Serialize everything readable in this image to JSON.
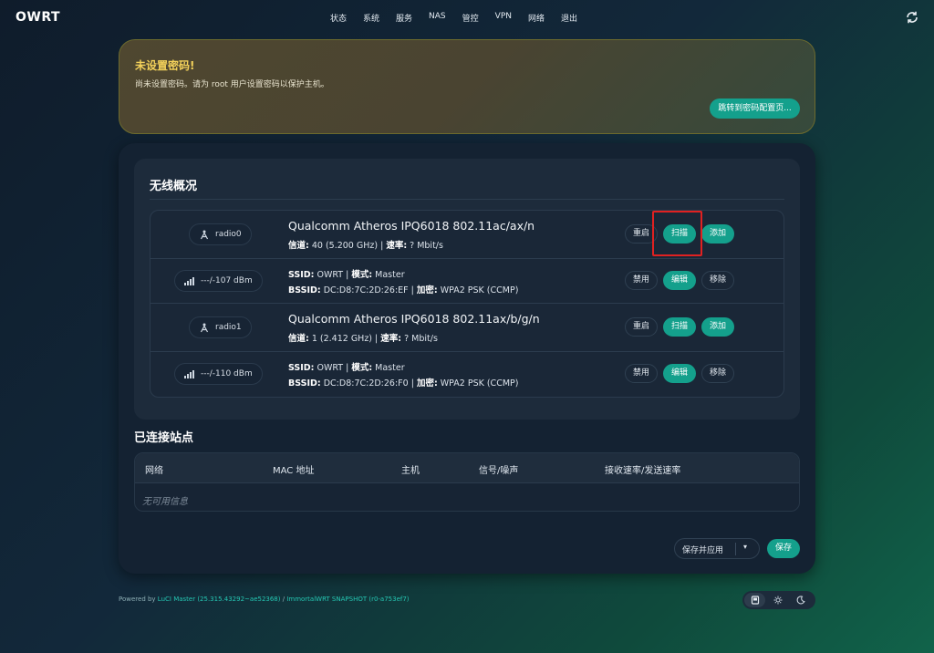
{
  "brand": "OWRT",
  "nav": [
    "状态",
    "系统",
    "服务",
    "NAS",
    "管控",
    "VPN",
    "网络",
    "退出"
  ],
  "warning": {
    "title": "未设置密码!",
    "text": "尚未设置密码。请为 root 用户设置密码以保护主机。",
    "button": "跳转到密码配置页..."
  },
  "wireless": {
    "title": "无线概况",
    "devices": [
      {
        "radio": "radio0",
        "title": "Qualcomm Atheros IPQ6018 802.11ac/ax/n",
        "channel_label": "信道:",
        "channel": " 40 (5.200 GHz) | ",
        "rate_label": "速率:",
        "rate": " ? Mbit/s",
        "buttons": [
          "重启",
          "扫描",
          "添加"
        ],
        "network": {
          "signal": "---/-107 dBm",
          "ssid_label": "SSID:",
          "ssid": " OWRT | ",
          "mode_label": "模式:",
          "mode": " Master",
          "bssid_label": "BSSID:",
          "bssid": " DC:D8:7C:2D:26:EF | ",
          "enc_label": "加密:",
          "enc": " WPA2 PSK (CCMP)",
          "buttons": [
            "禁用",
            "编辑",
            "移除"
          ]
        }
      },
      {
        "radio": "radio1",
        "title": "Qualcomm Atheros IPQ6018 802.11ax/b/g/n",
        "channel_label": "信道:",
        "channel": " 1 (2.412 GHz) | ",
        "rate_label": "速率:",
        "rate": " ? Mbit/s",
        "buttons": [
          "重启",
          "扫描",
          "添加"
        ],
        "network": {
          "signal": "---/-110 dBm",
          "ssid_label": "SSID:",
          "ssid": " OWRT | ",
          "mode_label": "模式:",
          "mode": " Master",
          "bssid_label": "BSSID:",
          "bssid": " DC:D8:7C:2D:26:F0 | ",
          "enc_label": "加密:",
          "enc": " WPA2 PSK (CCMP)",
          "buttons": [
            "禁用",
            "编辑",
            "移除"
          ]
        }
      }
    ]
  },
  "stations": {
    "title": "已连接站点",
    "columns": [
      "网络",
      "MAC 地址",
      "主机",
      "信号/噪声",
      "接收速率/发送速率"
    ],
    "empty": "无可用信息"
  },
  "actions": {
    "save_apply": "保存并应用",
    "save": "保存"
  },
  "footer": {
    "prefix": "Powered by ",
    "luci": "LuCI Master (25.315.43292~ae52368)",
    "sep": " / ",
    "firmware": "ImmortalWRT SNAPSHOT (r0-a753ef7)"
  },
  "colors": {
    "accent": "#14a08c",
    "warning_title": "#f3d15a",
    "highlight": "#e02121"
  },
  "icons": [
    "refresh-icon",
    "antenna-icon",
    "signal-bars-icon",
    "desktop-icon",
    "sun-icon",
    "moon-icon",
    "caret-down-icon"
  ]
}
